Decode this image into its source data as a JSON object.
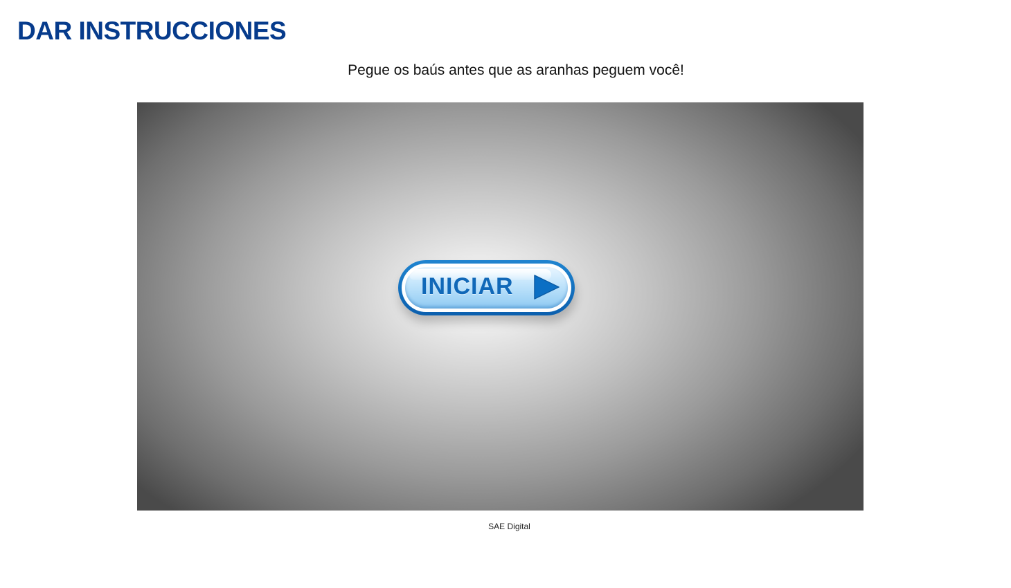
{
  "header": {
    "title": "DAR INSTRUCCIONES"
  },
  "instructions": {
    "text": "Pegue os baús antes que as aranhas peguem você!"
  },
  "game": {
    "start_button_label": "INICIAR",
    "start_button_icon": "play-icon",
    "colors": {
      "button_blue": "#0b5fae",
      "button_face": "#bfe3fb",
      "title_blue": "#063b8c"
    }
  },
  "footer": {
    "credit": "SAE Digital"
  }
}
